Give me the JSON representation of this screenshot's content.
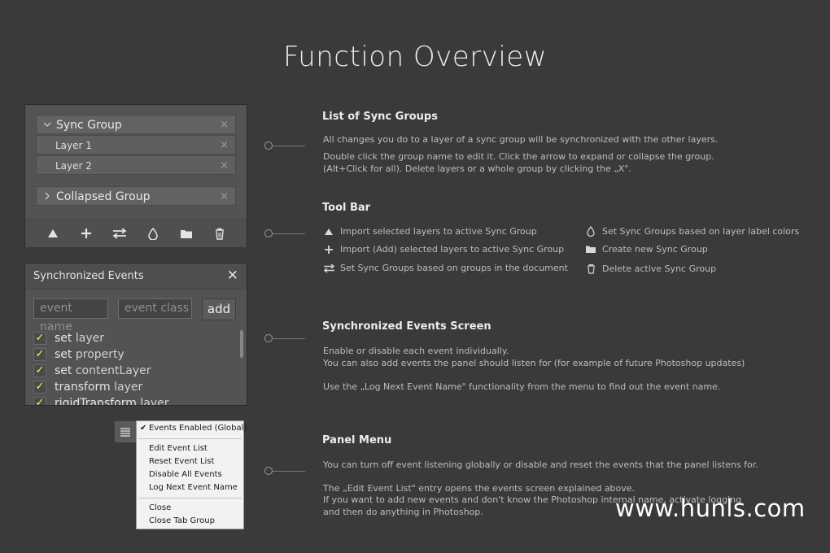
{
  "page": {
    "title": "Function Overview",
    "watermark": "www.hunls.com"
  },
  "sync_panel": {
    "group": {
      "name": "Sync Group",
      "expand_icon": "chevron-down-icon",
      "close": "×"
    },
    "layers": [
      {
        "name": "Layer 1",
        "close": "×"
      },
      {
        "name": "Layer 2",
        "close": "×"
      }
    ],
    "collapsed_group": {
      "name": "Collapsed Group",
      "expand_icon": "chevron-right-icon",
      "close": "×"
    },
    "toolbar_icons": [
      "triangle-up-icon",
      "plus-icon",
      "swap-arrows-icon",
      "droplet-icon",
      "folder-icon",
      "trash-icon"
    ]
  },
  "events_panel": {
    "title": "Synchronized Events",
    "close": "✕",
    "event_name_placeholder": "event name",
    "event_class_placeholder": "event class",
    "add_label": "add",
    "events": [
      {
        "verb": "set",
        "object": "layer",
        "checked": true
      },
      {
        "verb": "set",
        "object": "property",
        "checked": true
      },
      {
        "verb": "set",
        "object": "contentLayer",
        "checked": true
      },
      {
        "verb": "transform",
        "object": "layer",
        "checked": true
      },
      {
        "verb": "rigidTransform",
        "object": "layer",
        "checked": true
      }
    ]
  },
  "panel_menu": {
    "icon": "hamburger-menu-icon",
    "items": {
      "events_enabled": "Events Enabled (Global)",
      "edit_event_list": "Edit Event List",
      "reset_event_list": "Reset Event List",
      "disable_all_events": "Disable All Events",
      "log_next_event_name": "Log Next Event Name",
      "close": "Close",
      "close_tab_group": "Close Tab Group"
    },
    "checkmark": "✔"
  },
  "sections": {
    "sync_groups": {
      "title": "List of Sync Groups",
      "lines": [
        "All changes you do to a layer of a sync group will be synchronized with the other layers.",
        "Double click the group name to edit it. Click the arrow to expand or collapse the group.",
        "(Alt+Click for all). Delete layers or a whole group by clicking the „X\"."
      ]
    },
    "tool_bar": {
      "title": "Tool Bar",
      "items": [
        {
          "icon": "triangle-up-icon",
          "text": "Import selected layers to active Sync Group"
        },
        {
          "icon": "plus-icon",
          "text": "Import (Add) selected layers to active Sync Group"
        },
        {
          "icon": "swap-arrows-icon",
          "text": "Set Sync Groups based on groups in the document"
        },
        {
          "icon": "droplet-icon",
          "text": "Set Sync Groups based on layer label colors"
        },
        {
          "icon": "folder-icon",
          "text": "Create new Sync Group"
        },
        {
          "icon": "trash-icon",
          "text": "Delete active Sync Group"
        }
      ]
    },
    "events_screen": {
      "title": "Synchronized Events Screen",
      "lines": [
        "Enable or disable each event individually.",
        "You can also add events the panel should listen for (for example of future Photoshop updates)",
        "Use the „Log Next Event Name\" functionality from the menu to find out the event name."
      ]
    },
    "panel_menu": {
      "title": "Panel Menu",
      "lines": [
        "You can turn off event listening globally or disable and reset the events that the panel listens for.",
        "The „Edit Event List\" entry opens the events screen explained above.",
        "If you want to add new events and don't know the Photoshop internal name, activate logging",
        "and then do anything in Photoshop."
      ]
    }
  }
}
